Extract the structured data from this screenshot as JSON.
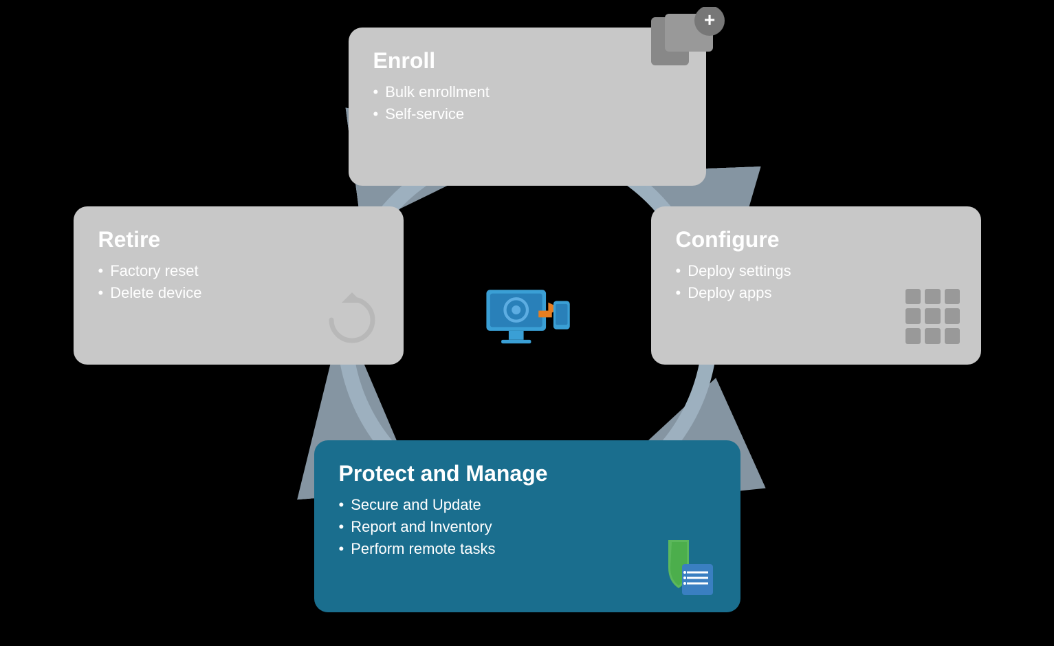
{
  "diagram": {
    "background": "#000000",
    "cards": {
      "enroll": {
        "title": "Enroll",
        "items": [
          "Bulk enrollment",
          "Self-service"
        ],
        "bg": "#c8c8c8"
      },
      "configure": {
        "title": "Configure",
        "items": [
          "Deploy settings",
          "Deploy apps"
        ],
        "bg": "#c8c8c8"
      },
      "protect": {
        "title": "Protect and Manage",
        "items": [
          "Secure and Update",
          "Report and Inventory",
          "Perform remote tasks"
        ],
        "bg": "#1a6e8e"
      },
      "retire": {
        "title": "Retire",
        "items": [
          "Factory reset",
          "Delete device"
        ],
        "bg": "#c8c8c8"
      }
    },
    "colors": {
      "card_gray": "#c5c5c5",
      "card_blue": "#1a6e8e",
      "arrow_color": "#b0c4d8",
      "center_blue": "#3498db"
    }
  }
}
